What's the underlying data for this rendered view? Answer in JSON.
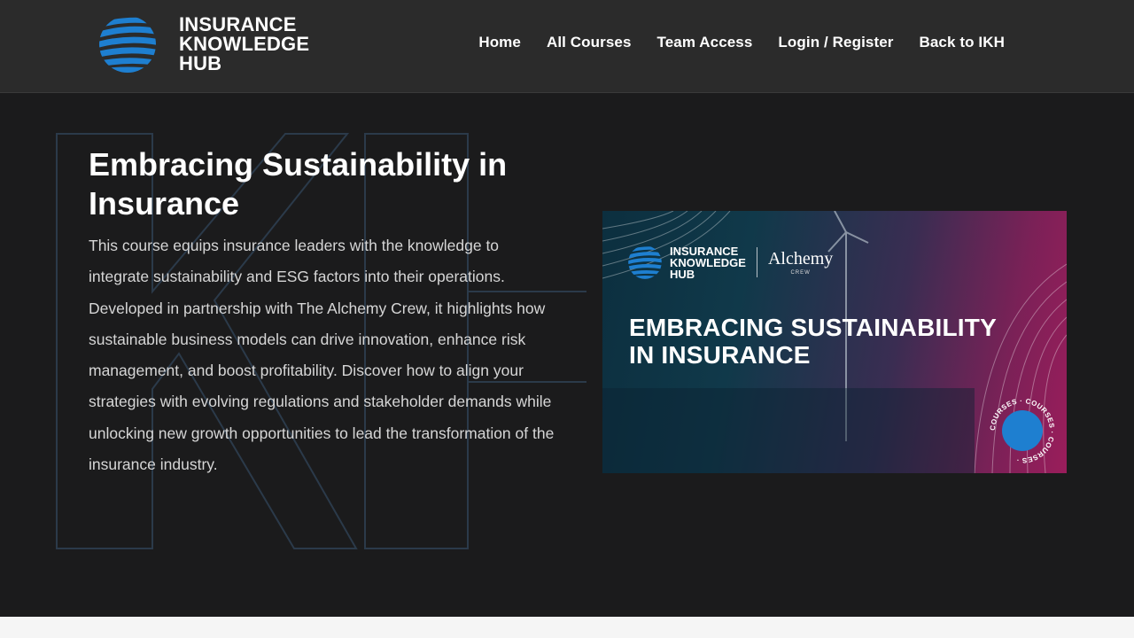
{
  "header": {
    "logo": {
      "lines": [
        "INSURANCE",
        "KNOWLEDGE",
        "HUB"
      ]
    },
    "nav": [
      {
        "label": "Home"
      },
      {
        "label": "All Courses"
      },
      {
        "label": "Team Access"
      },
      {
        "label": "Login / Register"
      },
      {
        "label": "Back to IKH"
      }
    ]
  },
  "hero": {
    "title": "Embracing Sustainability in Insurance",
    "description": "This course equips insurance leaders with the knowledge to integrate sustainability and ESG factors into their operations. Developed in partnership with The Alchemy Crew, it highlights how sustainable business models can drive innovation, enhance risk management, and boost profitability. Discover how to align your strategies with evolving regulations and stakeholder demands while unlocking new growth opportunities to lead the transformation of the insurance industry."
  },
  "banner": {
    "logo_lines": [
      "INSURANCE",
      "KNOWLEDGE",
      "HUB"
    ],
    "partner_name": "Alchemy",
    "partner_sub": "CREW",
    "title_lines": [
      "EMBRACING SUSTAINABILITY",
      "IN INSURANCE"
    ],
    "badge_text": "COURSES · COURSES · COURSES · "
  },
  "colors": {
    "header_bg": "#2b2b2b",
    "hero_bg": "#1b1b1c",
    "brand_blue": "#1e7fd0",
    "magenta": "#9a1d5b"
  }
}
